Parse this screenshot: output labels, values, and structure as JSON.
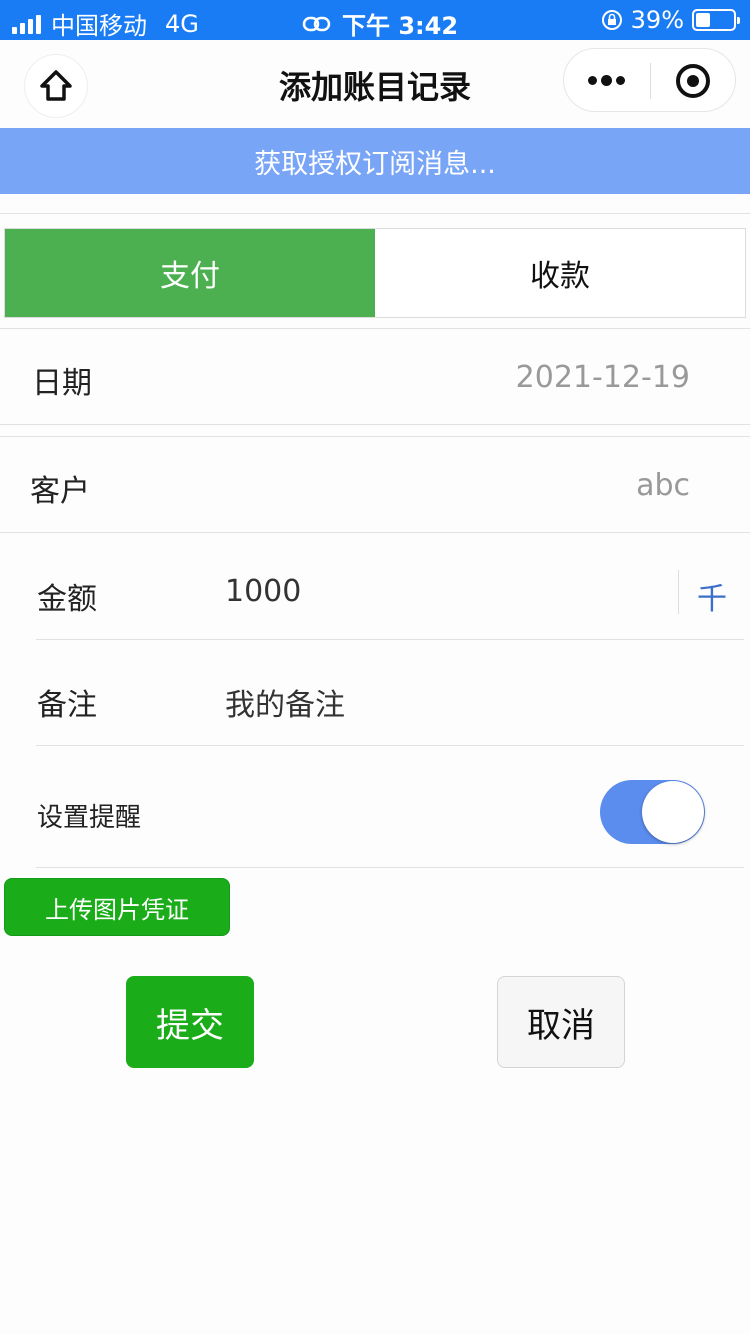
{
  "status_bar": {
    "carrier": "中国移动",
    "network": "4G",
    "time": "下午 3:42",
    "battery": "39%",
    "battery_level": 0.39
  },
  "nav": {
    "title": "添加账目记录"
  },
  "banner": {
    "text": "获取授权订阅消息..."
  },
  "tabs": [
    {
      "label": "支付",
      "active": true
    },
    {
      "label": "收款",
      "active": false
    }
  ],
  "form": {
    "date": {
      "label": "日期",
      "value": "2021-12-19"
    },
    "customer": {
      "label": "客户",
      "value": "abc"
    },
    "amount": {
      "label": "金额",
      "value": "1000",
      "unit": "千"
    },
    "note": {
      "label": "备注",
      "value": "我的备注"
    },
    "reminder": {
      "label": "设置提醒",
      "enabled": true
    }
  },
  "buttons": {
    "upload": "上传图片凭证",
    "submit": "提交",
    "cancel": "取消"
  },
  "colors": {
    "status_bar": "#1a7cf5",
    "banner": "#79a5f7",
    "active_tab": "#4caf50",
    "primary_button": "#1aad19",
    "switch_on": "#5b8def",
    "unit_text": "#3b6fc9"
  }
}
